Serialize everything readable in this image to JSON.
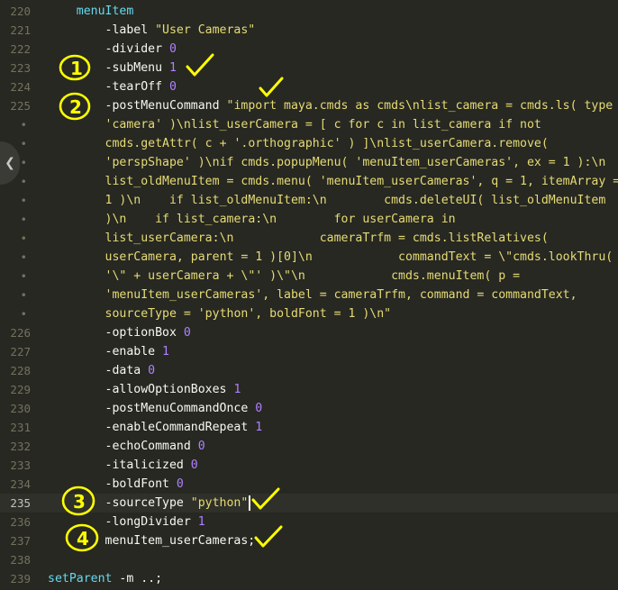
{
  "colors": {
    "background": "#272822",
    "keyword": "#66d9ef",
    "string": "#e6db74",
    "number": "#ae81ff",
    "line_number": "#75715e",
    "annotation": "#ffff00"
  },
  "editor": {
    "collapse_icon": "chevron-left-icon",
    "lines": [
      {
        "num": "220",
        "tokens": [
          {
            "t": "    "
          },
          {
            "t": "menuItem",
            "c": "kw"
          }
        ]
      },
      {
        "num": "221",
        "tokens": [
          {
            "t": "        -label "
          },
          {
            "t": "\"User Cameras\"",
            "c": "str"
          }
        ]
      },
      {
        "num": "222",
        "tokens": [
          {
            "t": "        -divider "
          },
          {
            "t": "0",
            "c": "num"
          }
        ]
      },
      {
        "num": "223",
        "tokens": [
          {
            "t": "        -subMenu "
          },
          {
            "t": "1",
            "c": "num"
          }
        ]
      },
      {
        "num": "224",
        "tokens": [
          {
            "t": "        -tearOff "
          },
          {
            "t": "0",
            "c": "num"
          }
        ]
      },
      {
        "num": "225",
        "tokens": [
          {
            "t": "        -postMenuCommand "
          },
          {
            "t": "\"import maya.cmds as cmds\\nlist_camera = cmds.ls( type =",
            "c": "str"
          }
        ]
      },
      {
        "num": "•",
        "wrap": true,
        "tokens": [
          {
            "t": "        "
          },
          {
            "t": "'camera' )\\nlist_userCamera = [ c for c in list_camera if not",
            "c": "str"
          }
        ]
      },
      {
        "num": "•",
        "wrap": true,
        "tokens": [
          {
            "t": "        "
          },
          {
            "t": "cmds.getAttr( c + '.orthographic' ) ]\\nlist_userCamera.remove(",
            "c": "str"
          }
        ]
      },
      {
        "num": "•",
        "wrap": true,
        "tokens": [
          {
            "t": "        "
          },
          {
            "t": "'perspShape' )\\nif cmds.popupMenu( 'menuItem_userCameras', ex = 1 ):\\n",
            "c": "str"
          }
        ]
      },
      {
        "num": "•",
        "wrap": true,
        "tokens": [
          {
            "t": "        "
          },
          {
            "t": "list_oldMenuItem = cmds.menu( 'menuItem_userCameras', q = 1, itemArray =",
            "c": "str"
          }
        ]
      },
      {
        "num": "•",
        "wrap": true,
        "tokens": [
          {
            "t": "        "
          },
          {
            "t": "1 )\\n    if list_oldMenuItem:\\n        cmds.deleteUI( list_oldMenuItem",
            "c": "str"
          }
        ]
      },
      {
        "num": "•",
        "wrap": true,
        "tokens": [
          {
            "t": "        "
          },
          {
            "t": ")\\n    if list_camera:\\n        for userCamera in",
            "c": "str"
          }
        ]
      },
      {
        "num": "•",
        "wrap": true,
        "tokens": [
          {
            "t": "        "
          },
          {
            "t": "list_userCamera:\\n            cameraTrfm = cmds.listRelatives(",
            "c": "str"
          }
        ]
      },
      {
        "num": "•",
        "wrap": true,
        "tokens": [
          {
            "t": "        "
          },
          {
            "t": "userCamera, parent = 1 )[0]\\n            commandText = \\\"cmds.lookThru(",
            "c": "str"
          }
        ]
      },
      {
        "num": "•",
        "wrap": true,
        "tokens": [
          {
            "t": "        "
          },
          {
            "t": "'\\\" + userCamera + \\\"' )\\\"\\n            cmds.menuItem( p =",
            "c": "str"
          }
        ]
      },
      {
        "num": "•",
        "wrap": true,
        "tokens": [
          {
            "t": "        "
          },
          {
            "t": "'menuItem_userCameras', label = cameraTrfm, command = commandText,",
            "c": "str"
          }
        ]
      },
      {
        "num": "•",
        "wrap": true,
        "tokens": [
          {
            "t": "        "
          },
          {
            "t": "sourceType = 'python', boldFont = 1 )\\n\"",
            "c": "str"
          }
        ]
      },
      {
        "num": "226",
        "tokens": [
          {
            "t": "        -optionBox "
          },
          {
            "t": "0",
            "c": "num"
          }
        ]
      },
      {
        "num": "227",
        "tokens": [
          {
            "t": "        -enable "
          },
          {
            "t": "1",
            "c": "num"
          }
        ]
      },
      {
        "num": "228",
        "tokens": [
          {
            "t": "        -data "
          },
          {
            "t": "0",
            "c": "num"
          }
        ]
      },
      {
        "num": "229",
        "tokens": [
          {
            "t": "        -allowOptionBoxes "
          },
          {
            "t": "1",
            "c": "num"
          }
        ]
      },
      {
        "num": "230",
        "tokens": [
          {
            "t": "        -postMenuCommandOnce "
          },
          {
            "t": "0",
            "c": "num"
          }
        ]
      },
      {
        "num": "231",
        "tokens": [
          {
            "t": "        -enableCommandRepeat "
          },
          {
            "t": "1",
            "c": "num"
          }
        ]
      },
      {
        "num": "232",
        "tokens": [
          {
            "t": "        -echoCommand "
          },
          {
            "t": "0",
            "c": "num"
          }
        ]
      },
      {
        "num": "233",
        "tokens": [
          {
            "t": "        -italicized "
          },
          {
            "t": "0",
            "c": "num"
          }
        ]
      },
      {
        "num": "234",
        "tokens": [
          {
            "t": "        -boldFont "
          },
          {
            "t": "0",
            "c": "num"
          }
        ]
      },
      {
        "num": "235",
        "current": true,
        "tokens": [
          {
            "t": "        -sourceType "
          },
          {
            "t": "\"python\"",
            "c": "str"
          }
        ]
      },
      {
        "num": "236",
        "tokens": [
          {
            "t": "        -longDivider "
          },
          {
            "t": "1",
            "c": "num"
          }
        ]
      },
      {
        "num": "237",
        "tokens": [
          {
            "t": "        menuItem_userCameras;"
          }
        ]
      },
      {
        "num": "238",
        "tokens": [
          {
            "t": ""
          }
        ]
      },
      {
        "num": "239",
        "tokens": [
          {
            "t": "setParent",
            "c": "kw"
          },
          {
            "t": " -m ..;"
          }
        ]
      }
    ]
  },
  "annotations": [
    {
      "label": "1",
      "icon": "checkmark-icon"
    },
    {
      "label": "2",
      "icon": "checkmark-icon"
    },
    {
      "label": "3",
      "icon": "checkmark-icon"
    },
    {
      "label": "4",
      "icon": "checkmark-icon"
    }
  ]
}
